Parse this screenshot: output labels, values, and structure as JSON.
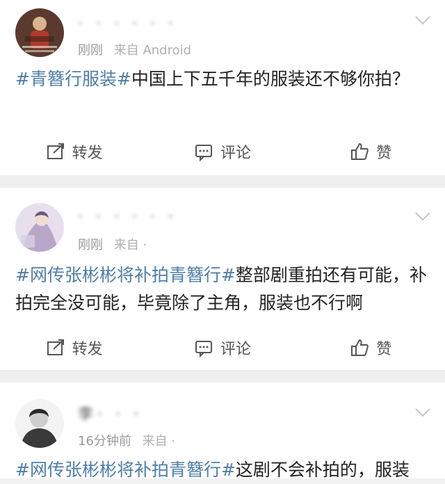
{
  "posts": [
    {
      "name": "· · · · · ·",
      "time": "刚刚",
      "source": "来自 Android",
      "content": [
        {
          "text": "#青簪行服装#",
          "topic": true
        },
        {
          "text": "中国上下五千年的服装还不够你拍？",
          "topic": false
        }
      ],
      "actions": {
        "repost": "转发",
        "comment": "评论",
        "like": "赞"
      }
    },
    {
      "name": "· · · · · ·",
      "time": "刚刚",
      "source": "来自 ·",
      "content": [
        {
          "text": "#网传张彬彬将补拍青簪行#",
          "topic": true
        },
        {
          "text": "整部剧重拍还有可能，补拍完全没可能，毕竟除了主角，服装也不行啊",
          "topic": false
        }
      ],
      "actions": {
        "repost": "转发",
        "comment": "评论",
        "like": "赞"
      }
    },
    {
      "name": "李· · ·",
      "time": "16分钟前",
      "source": "来自 ·",
      "content": [
        {
          "text": "#网传张彬彬将补拍青簪行#",
          "topic": true
        },
        {
          "text": "这剧不会补拍的，服装",
          "topic": false
        }
      ]
    }
  ],
  "colors": {
    "topic": "#4e7ea9",
    "meta": "#9a9a9a",
    "separator": "#efefef"
  }
}
